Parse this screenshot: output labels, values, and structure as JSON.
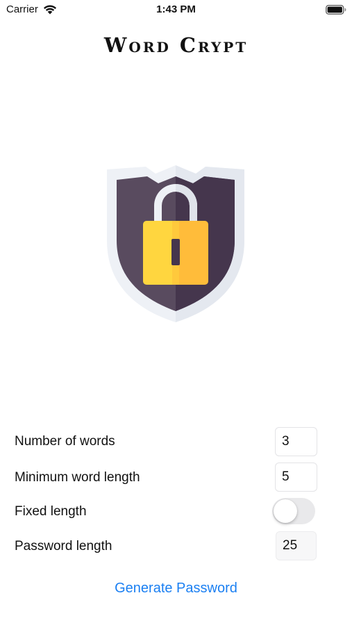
{
  "status_bar": {
    "carrier": "Carrier",
    "time": "1:43 PM",
    "wifi_icon": "wifi-icon",
    "battery_icon": "battery-full-icon"
  },
  "app": {
    "title": "Word Crypt",
    "logo_icon": "shield-padlock-icon"
  },
  "settings": {
    "number_of_words": {
      "label": "Number of words",
      "value": "3"
    },
    "minimum_word_length": {
      "label": "Minimum word length",
      "value": "5"
    },
    "fixed_length": {
      "label": "Fixed length",
      "enabled": false
    },
    "password_length": {
      "label": "Password length",
      "value": "25"
    }
  },
  "actions": {
    "generate_label": "Generate Password"
  },
  "colors": {
    "accent": "#1a7ff2",
    "shield_dark": "#4a3a52",
    "shield_rim": "#eef1f6",
    "lock_yellow": "#ffd33d",
    "lock_orange": "#ffbc3a"
  }
}
